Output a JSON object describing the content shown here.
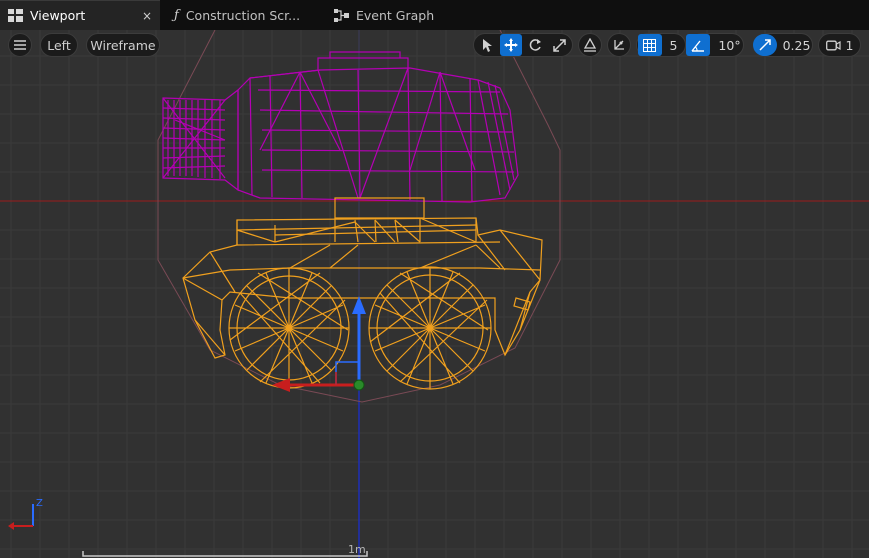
{
  "tabs": [
    {
      "label": "Viewport",
      "icon": "viewport-grid-icon",
      "active": true,
      "close": "×"
    },
    {
      "label": "Construction Scr...",
      "icon": "function-icon",
      "glyph": "ƒ",
      "active": false
    },
    {
      "label": "Event Graph",
      "icon": "node-graph-icon",
      "active": false
    }
  ],
  "toolbar": {
    "menu_icon": "hamburger-menu-icon",
    "view_mode": "Left",
    "render_mode": "Wireframe",
    "transform_tools": [
      "select-arrow-icon",
      "translate-move-icon",
      "rotate-icon",
      "scale-icon"
    ],
    "active_tool": "translate-move-icon",
    "surface_snap_icon": "surface-snap-icon",
    "local_world_icon": "world-local-icon",
    "grid_snap_value": "5",
    "rotation_snap_value": "10°",
    "scale_snap_value": "0.25",
    "camera_speed_value": "1"
  },
  "viewport": {
    "scale_label": "1m",
    "axis_indicator_z": "Z",
    "colors": {
      "background": "#313131",
      "grid_minor": "#3a3a3a",
      "grid_major": "#454545",
      "turret_wire": "#b400b4",
      "hull_wire": "#f0a01e",
      "accent": "#0f6fd0",
      "axis_x": "#c81e1e",
      "axis_y": "#28c828",
      "axis_z": "#2a6cff"
    }
  }
}
